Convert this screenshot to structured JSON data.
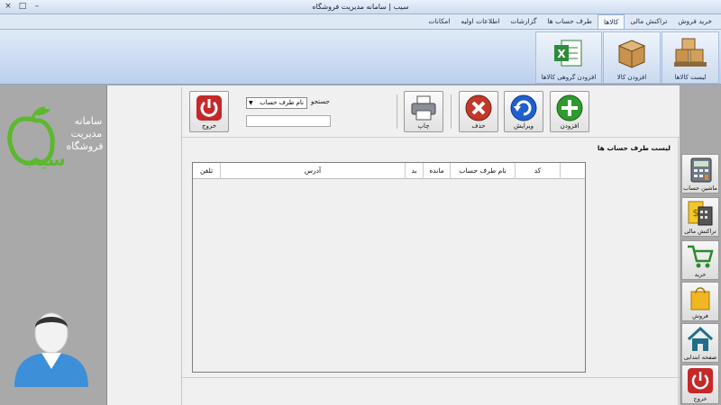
{
  "window": {
    "title": "سیب | سامانه مدیریت فروشگاه",
    "controls": [
      "×",
      "□",
      "–"
    ]
  },
  "ribbon": {
    "tabs": [
      {
        "label": "خرید فروش"
      },
      {
        "label": "تراکنش مالی"
      },
      {
        "label": "کالاها",
        "active": true
      },
      {
        "label": "طرف حساب ها"
      },
      {
        "label": "گزارشات"
      },
      {
        "label": "اطلاعات اولیه"
      },
      {
        "label": "امکانات"
      }
    ],
    "buttons": [
      {
        "label": "لیست کالاها",
        "icon": "boxes-stack-icon"
      },
      {
        "label": "افزودن کالا",
        "icon": "box-icon"
      },
      {
        "label": "افزودن گروهی کالاها",
        "icon": "excel-icon"
      }
    ]
  },
  "sidebar": {
    "items": [
      {
        "label": "ماشین حساب",
        "icon": "calculator-icon"
      },
      {
        "label": "تراکنش مالی",
        "icon": "money-calculator-icon"
      },
      {
        "label": "خرید",
        "icon": "cart-icon"
      },
      {
        "label": "فروش",
        "icon": "shopping-bag-icon"
      },
      {
        "label": "صفحه ابتدایی",
        "icon": "home-icon"
      },
      {
        "label": "خروج",
        "icon": "power-icon"
      }
    ]
  },
  "logo": {
    "text_line1": "سامانه",
    "text_line2": "مدیریت",
    "text_line3": "فروشگاه",
    "brand": "سیب"
  },
  "toolbar": {
    "add_label": "افزودن",
    "edit_label": "ویرایش",
    "delete_label": "حذف",
    "print_label": "چاپ",
    "exit_label": "خروج",
    "search_label": "جستجو",
    "search_field": "نام طرف حساب",
    "search_value": ""
  },
  "list": {
    "title": "لیست طرف حساب ها",
    "columns": [
      "کد",
      "نام طرف حساب",
      "مانده",
      "بد",
      "آدرس",
      "تلفن"
    ],
    "rows": []
  },
  "colors": {
    "ribbon": "#cddcf0",
    "add_green": "#2e9b2e",
    "edit_blue": "#1f5fd0",
    "delete_red": "#c0392b",
    "exit_red": "#c62828",
    "logo_green": "#5cb82e"
  }
}
